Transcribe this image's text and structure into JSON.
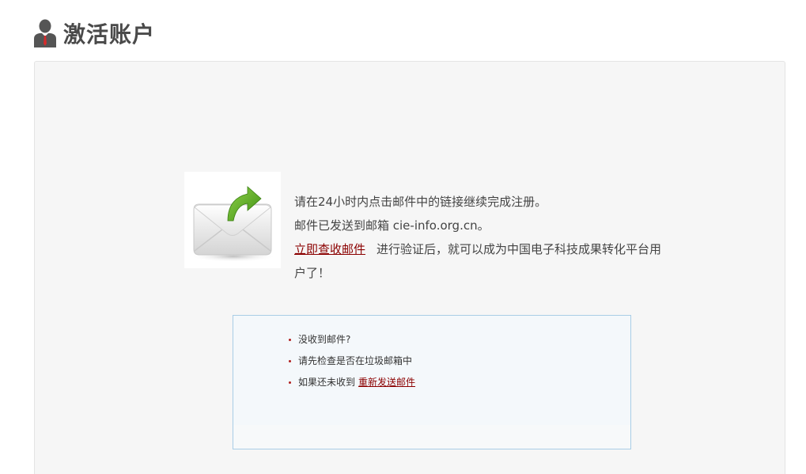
{
  "header": {
    "title": "激活账户",
    "icon": "user-icon"
  },
  "notice": {
    "illustration": "mail-send-icon",
    "line1": "请在24小时内点击邮件中的链接继续完成注册。",
    "line2": "邮件已发送到邮箱 cie-info.org.cn。",
    "check_link": "立即查收邮件",
    "line3_rest": "进行验证后，就可以成为中国电子科技成果转化平台用",
    "line4": "户了！"
  },
  "tips": {
    "items": [
      "没收到邮件?",
      "请先检查是否在垃圾邮箱中",
      "如果还未收到"
    ],
    "resend_link": "重新发送邮件"
  },
  "colors": {
    "link": "#8b0000",
    "tips_border": "#a9cde6",
    "panel_bg": "#f6f6f6",
    "arrow_green": "#5cae1e"
  }
}
